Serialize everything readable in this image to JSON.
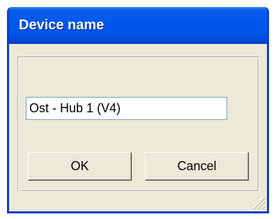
{
  "dialog": {
    "title": "Device name",
    "name_value": "Ost - Hub 1 (V4)",
    "ok_label": "OK",
    "cancel_label": "Cancel"
  },
  "colors": {
    "titlebar": "#0058ee",
    "face": "#ece9d8",
    "input_border": "#7f9db9"
  },
  "icons": {
    "resize_grip": "resize-grip-icon"
  }
}
